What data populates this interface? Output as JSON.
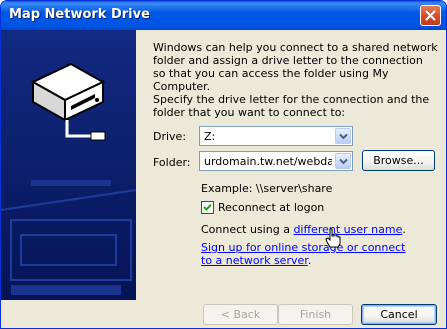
{
  "window": {
    "title": "Map Network Drive"
  },
  "intro_text": "Windows can help you connect to a shared network folder and assign a drive letter to the connection so that you can access the folder using My Computer.",
  "specify_text": "Specify the drive letter for the connection and the folder that you want to connect to:",
  "drive": {
    "label": "Drive:",
    "value": "Z:"
  },
  "folder": {
    "label": "Folder:",
    "value": "urdomain.tw.net/webdav",
    "browse_label": "Browse..."
  },
  "example_text": "Example: \\\\server\\share",
  "reconnect": {
    "label": "Reconnect at logon",
    "checked": true
  },
  "connect_using": {
    "prefix": "Connect using a ",
    "link": "different user name",
    "suffix": "."
  },
  "signup_link": "Sign up for online storage or connect to a network server",
  "signup_suffix": ".",
  "buttons": {
    "back": "< Back",
    "finish": "Finish",
    "cancel": "Cancel"
  },
  "icons": {
    "close": "close-icon",
    "drive": "network-drive-icon",
    "cursor": "hand-cursor-icon"
  }
}
